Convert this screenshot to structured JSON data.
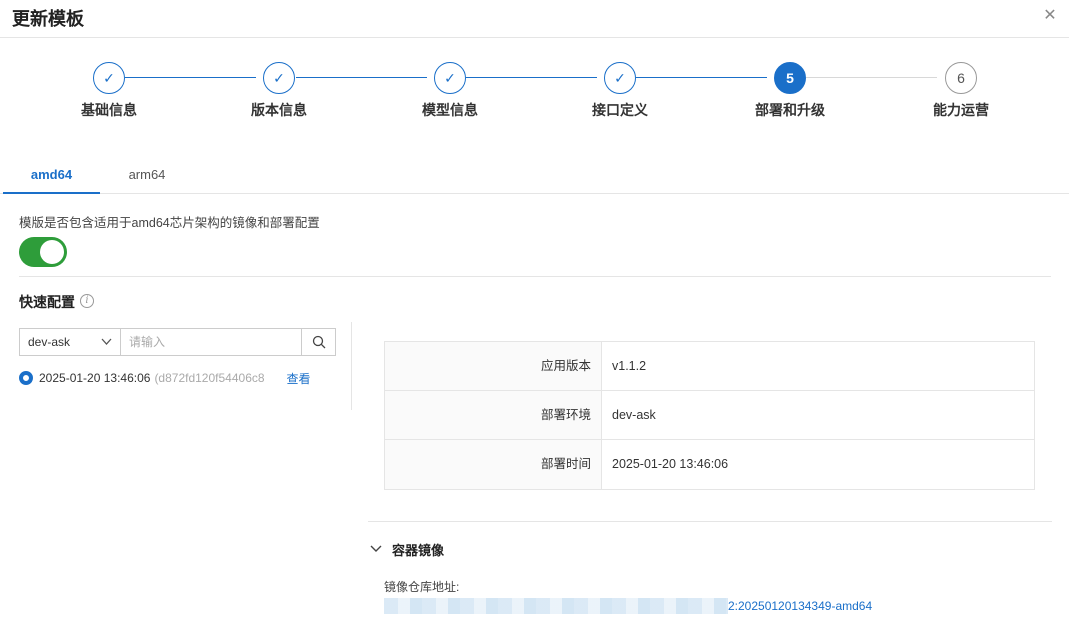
{
  "header": {
    "title": "更新模板",
    "close_icon": "close-icon"
  },
  "steps": [
    {
      "label": "基础信息",
      "status": "done",
      "mark": "✓"
    },
    {
      "label": "版本信息",
      "status": "done",
      "mark": "✓"
    },
    {
      "label": "模型信息",
      "status": "done",
      "mark": "✓"
    },
    {
      "label": "接口定义",
      "status": "done",
      "mark": "✓"
    },
    {
      "label": "部署和升级",
      "status": "active",
      "mark": "5"
    },
    {
      "label": "能力运营",
      "status": "todo",
      "mark": "6"
    }
  ],
  "tabs": [
    {
      "label": "amd64",
      "active": true
    },
    {
      "label": "arm64",
      "active": false
    }
  ],
  "arch": {
    "description": "模版是否包含适用于amd64芯片架构的镜像和部署配置",
    "toggle_on": true
  },
  "quick_config": {
    "title": "快速配置",
    "info_icon": "info-icon",
    "select_value": "dev-ask",
    "search_placeholder": "请输入",
    "record": {
      "time": "2025-01-20 13:46:06",
      "hash": "(d872fd120f54406c8",
      "action": "查看"
    }
  },
  "details": {
    "rows": [
      {
        "key": "应用版本",
        "value": "v1.1.2"
      },
      {
        "key": "部署环境",
        "value": "dev-ask"
      },
      {
        "key": "部署时间",
        "value": "2025-01-20 13:46:06"
      }
    ]
  },
  "container": {
    "section_title": "容器镜像",
    "repo_label": "镜像仓库地址:",
    "repo_value_visible": "2:20250120134349-amd64"
  },
  "colors": {
    "primary": "#1a6fc9",
    "toggle": "#2e9d3a"
  }
}
